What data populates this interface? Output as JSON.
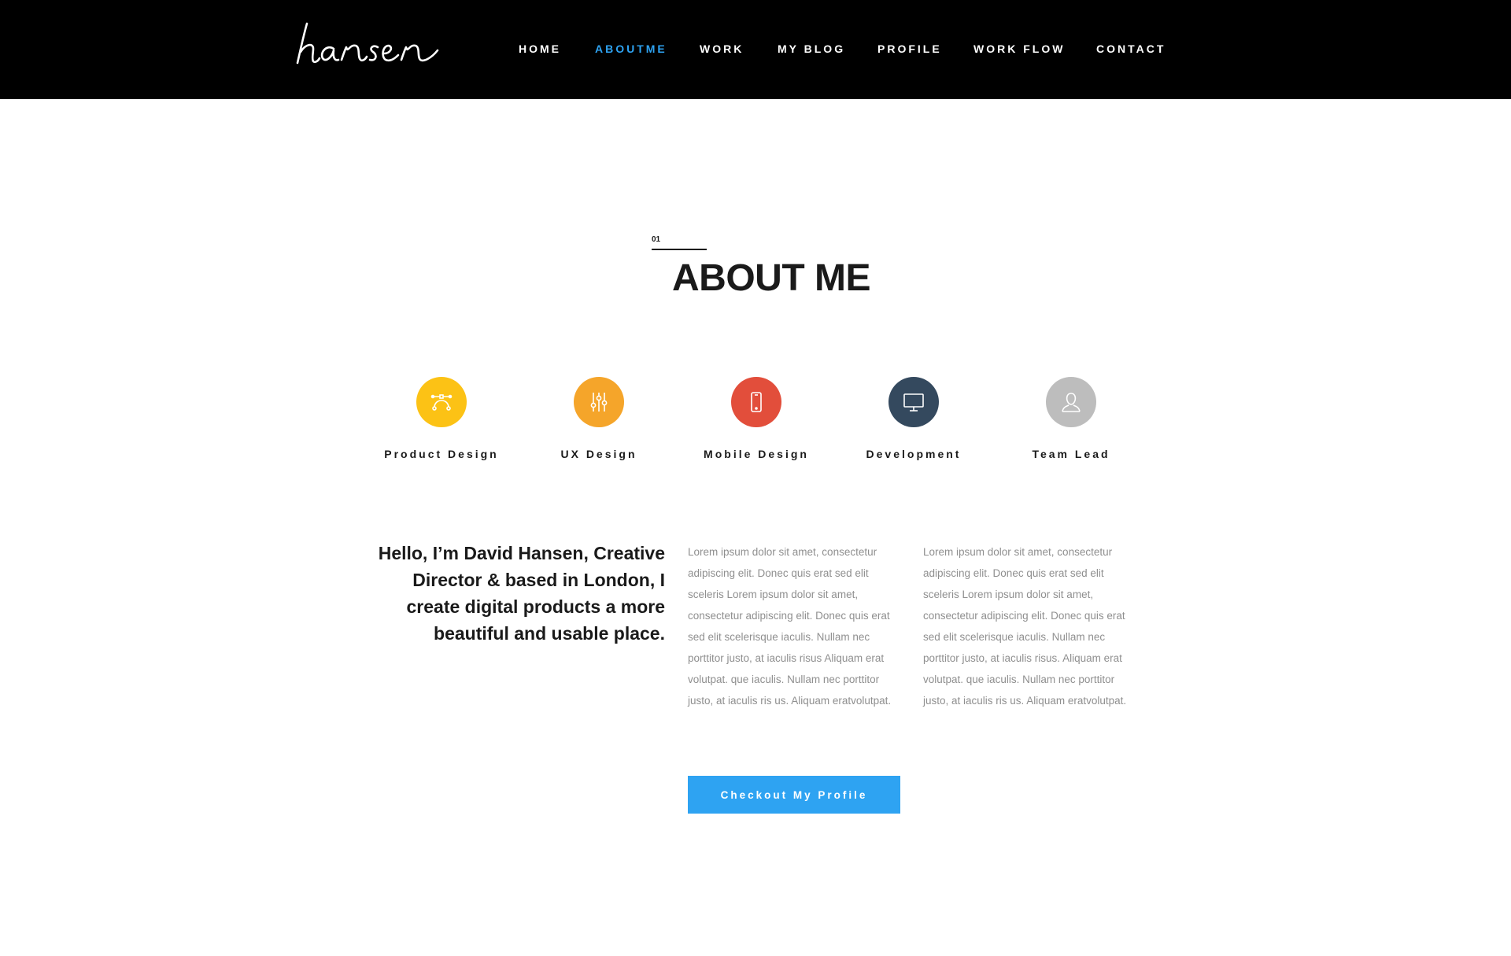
{
  "header": {
    "logo_text": "hansen",
    "nav": [
      {
        "label": "HOME",
        "active": false
      },
      {
        "label": "ABOUTME",
        "active": true
      },
      {
        "label": "WORK",
        "active": false
      },
      {
        "label": "MY BLOG",
        "active": false
      },
      {
        "label": "PROFILE",
        "active": false
      },
      {
        "label": "WORK FLOW",
        "active": false
      },
      {
        "label": "CONTACT",
        "active": false
      }
    ]
  },
  "section": {
    "number": "01",
    "title": "ABOUT ME"
  },
  "skills": [
    {
      "label": "Product Design",
      "color": "#fcc215",
      "icon": "bezier-curve-icon"
    },
    {
      "label": "UX Design",
      "color": "#f5a52a",
      "icon": "sliders-icon"
    },
    {
      "label": "Mobile Design",
      "color": "#e24e3b",
      "icon": "smartphone-icon"
    },
    {
      "label": "Development",
      "color": "#34495e",
      "icon": "monitor-icon"
    },
    {
      "label": "Team Lead",
      "color": "#bdbdbd",
      "icon": "user-icon"
    }
  ],
  "intro": {
    "headline": "Hello, I’m David Hansen, Creative Director & based in London, I create digital products a more beautiful and usable place.",
    "paragraph_1": "Lorem ipsum dolor sit amet, consectetur adipiscing elit. Donec quis erat sed elit sceleris Lorem ipsum dolor sit amet, consectetur adipiscing elit. Donec quis erat sed elit scelerisque iaculis. Nullam nec porttitor justo, at iaculis risus Aliquam erat volutpat. que iaculis. Nullam nec porttitor justo, at iaculis ris us. Aliquam eratvolutpat.",
    "paragraph_2": "Lorem ipsum dolor sit amet, consectetur adipiscing elit. Donec quis erat sed elit sceleris Lorem ipsum dolor sit amet, consectetur adipiscing elit. Donec quis erat sed elit scelerisque iaculis. Nullam nec porttitor justo, at iaculis risus. Aliquam erat volutpat. que iaculis. Nullam nec porttitor justo, at iaculis ris us. Aliquam eratvolutpat."
  },
  "cta": {
    "label": "Checkout My Profile"
  },
  "colors": {
    "accent": "#2ea3f2",
    "header_bg": "#000000"
  }
}
